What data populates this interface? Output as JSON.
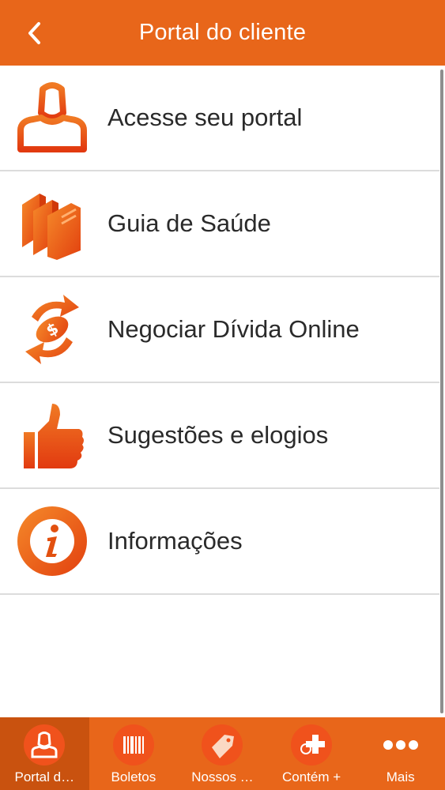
{
  "header": {
    "title": "Portal do cliente",
    "back_icon": "chevron-left-icon"
  },
  "colors": {
    "accent": "#e8661a",
    "accent_dark": "#c9520f",
    "text": "#2a2a2a",
    "divider": "#dcdcdc"
  },
  "menu": [
    {
      "label": "Acesse seu portal",
      "icon": "user-icon"
    },
    {
      "label": "Guia de Saúde",
      "icon": "books-icon"
    },
    {
      "label": "Negociar Dívida Online",
      "icon": "money-exchange-icon"
    },
    {
      "label": "Sugestões e elogios",
      "icon": "thumbs-up-icon"
    },
    {
      "label": "Informações",
      "icon": "info-icon"
    }
  ],
  "tabs": [
    {
      "label": "Portal d…",
      "icon": "user-icon",
      "active": true
    },
    {
      "label": "Boletos",
      "icon": "barcode-icon"
    },
    {
      "label": "Nossos …",
      "icon": "tag-icon"
    },
    {
      "label": "Contém +",
      "icon": "plus-icon"
    },
    {
      "label": "Mais",
      "icon": "more-dots-icon"
    }
  ]
}
